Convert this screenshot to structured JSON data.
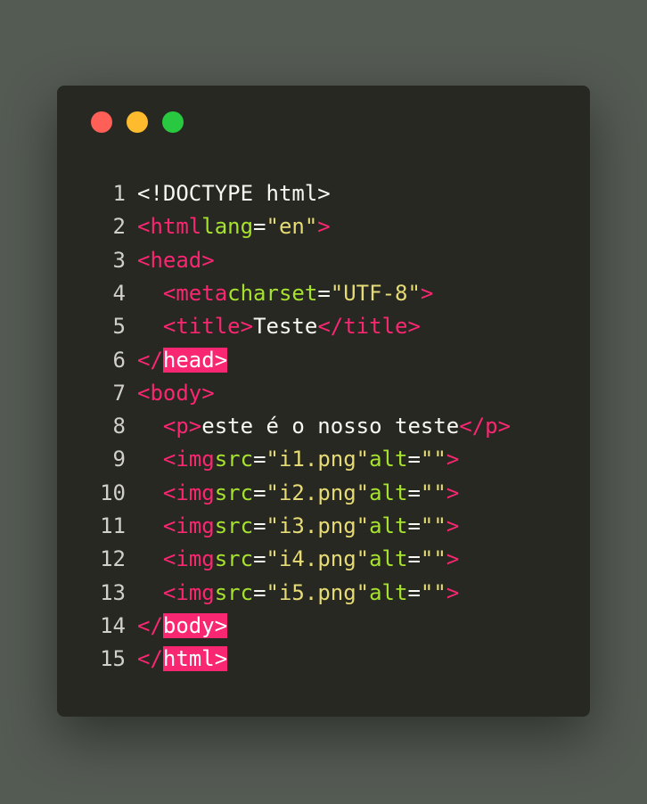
{
  "window": {
    "buttons": {
      "close_color": "#fe5f57",
      "minimize_color": "#febb2e",
      "maximize_color": "#28c840"
    }
  },
  "theme": {
    "background": "#272822",
    "tag_color": "#f92672",
    "attribute_color": "#a6e22e",
    "string_color": "#e6db74",
    "text_color": "#f8f8f2"
  },
  "code": {
    "lines": [
      {
        "number": "1",
        "indent": "",
        "doctype": "<!DOCTYPE html>"
      },
      {
        "number": "2",
        "indent": "",
        "open": "<html",
        "attr": "lang",
        "eq": "=",
        "value": "\"en\"",
        "close": ">"
      },
      {
        "number": "3",
        "indent": "",
        "open": "<head>"
      },
      {
        "number": "4",
        "indent": "  ",
        "open": "<meta",
        "attr": "charset",
        "eq": "=",
        "value": "\"UTF-8\"",
        "close": ">"
      },
      {
        "number": "5",
        "indent": "  ",
        "open": "<title>",
        "text": "Teste",
        "end": "</title>"
      },
      {
        "number": "6",
        "indent": "",
        "prefix": "</",
        "highlight": "head>"
      },
      {
        "number": "7",
        "indent": "",
        "open": "<body>"
      },
      {
        "number": "8",
        "indent": "  ",
        "open": "<p>",
        "text": "este é o nosso teste",
        "end": "</p>"
      },
      {
        "number": "9",
        "indent": "  ",
        "open": "<img",
        "attr": "src",
        "eq": "=",
        "value": "\"i1.png\"",
        "attr2": "alt",
        "eq2": "=",
        "value2": "\"\"",
        "close": ">"
      },
      {
        "number": "10",
        "indent": "  ",
        "open": "<img",
        "attr": "src",
        "eq": "=",
        "value": "\"i2.png\"",
        "attr2": "alt",
        "eq2": "=",
        "value2": "\"\"",
        "close": ">"
      },
      {
        "number": "11",
        "indent": "  ",
        "open": "<img",
        "attr": "src",
        "eq": "=",
        "value": "\"i3.png\"",
        "attr2": "alt",
        "eq2": "=",
        "value2": "\"\"",
        "close": ">"
      },
      {
        "number": "12",
        "indent": "  ",
        "open": "<img",
        "attr": "src",
        "eq": "=",
        "value": "\"i4.png\"",
        "attr2": "alt",
        "eq2": "=",
        "value2": "\"\"",
        "close": ">"
      },
      {
        "number": "13",
        "indent": "  ",
        "open": "<img",
        "attr": "src",
        "eq": "=",
        "value": "\"i5.png\"",
        "attr2": "alt",
        "eq2": "=",
        "value2": "\"\"",
        "close": ">"
      },
      {
        "number": "14",
        "indent": "",
        "prefix": "</",
        "highlight": "body>"
      },
      {
        "number": "15",
        "indent": "",
        "prefix": "</",
        "highlight": "html>"
      }
    ]
  }
}
